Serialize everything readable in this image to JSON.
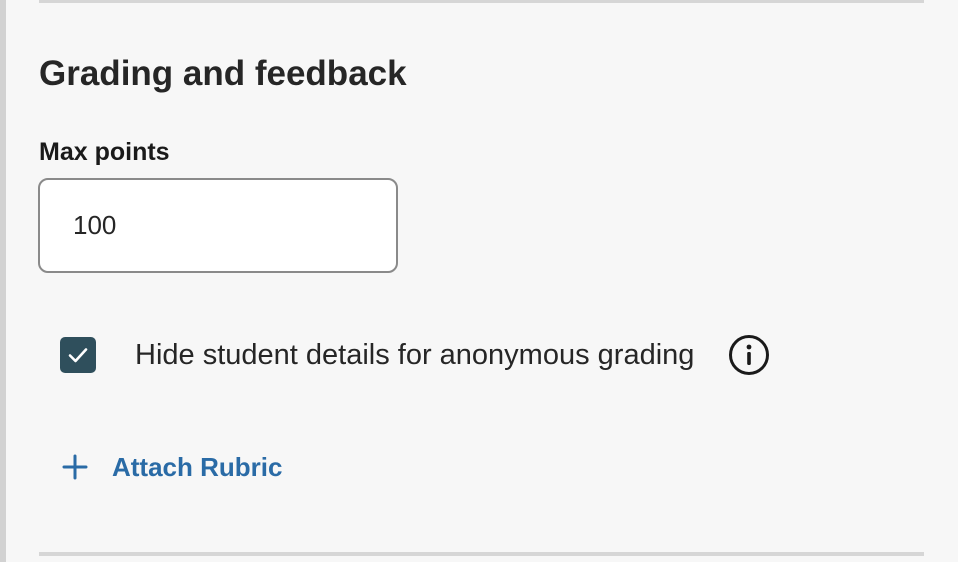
{
  "section": {
    "title": "Grading and feedback"
  },
  "max_points": {
    "label": "Max points",
    "value": "100"
  },
  "anonymous_grading": {
    "label": "Hide student details for anonymous grading",
    "checked": true,
    "info_icon": "info-icon"
  },
  "rubric": {
    "attach_label": "Attach Rubric",
    "icon": "plus-icon"
  },
  "colors": {
    "background": "#f7f7f7",
    "checkbox": "#2f4f5c",
    "link": "#2a6ba6",
    "divider": "#d6d6d6"
  }
}
